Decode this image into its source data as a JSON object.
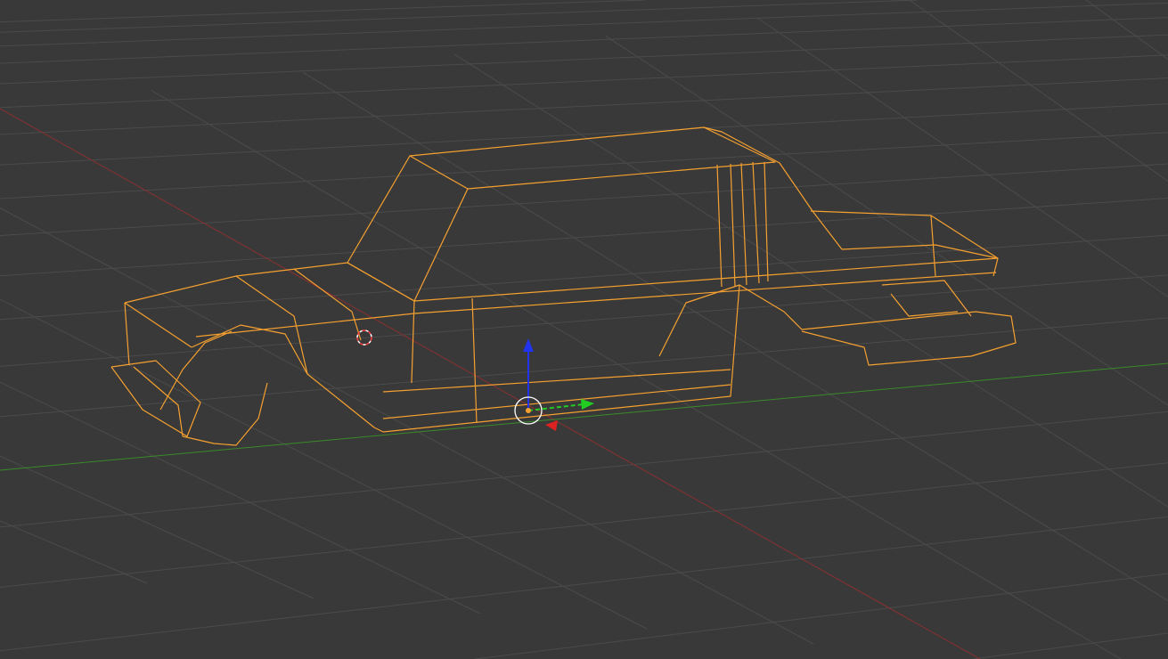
{
  "viewport": {
    "background_color": "#393939",
    "grid_color": "#4b4b4b",
    "x_axis_color": "#8a3030",
    "y_axis_color": "#3a8a2a",
    "mesh_color": "#f5a030",
    "mesh_inner_color": "#d8c8a8",
    "object": {
      "name_icon": "wireframe-car-mesh",
      "selected": true
    },
    "gizmo": {
      "icon": "translate-gizmo",
      "z_color": "#2233ee",
      "y_color": "#22cc22",
      "x_color": "#dd2222"
    },
    "cursor_icon": "3d-cursor-icon"
  }
}
